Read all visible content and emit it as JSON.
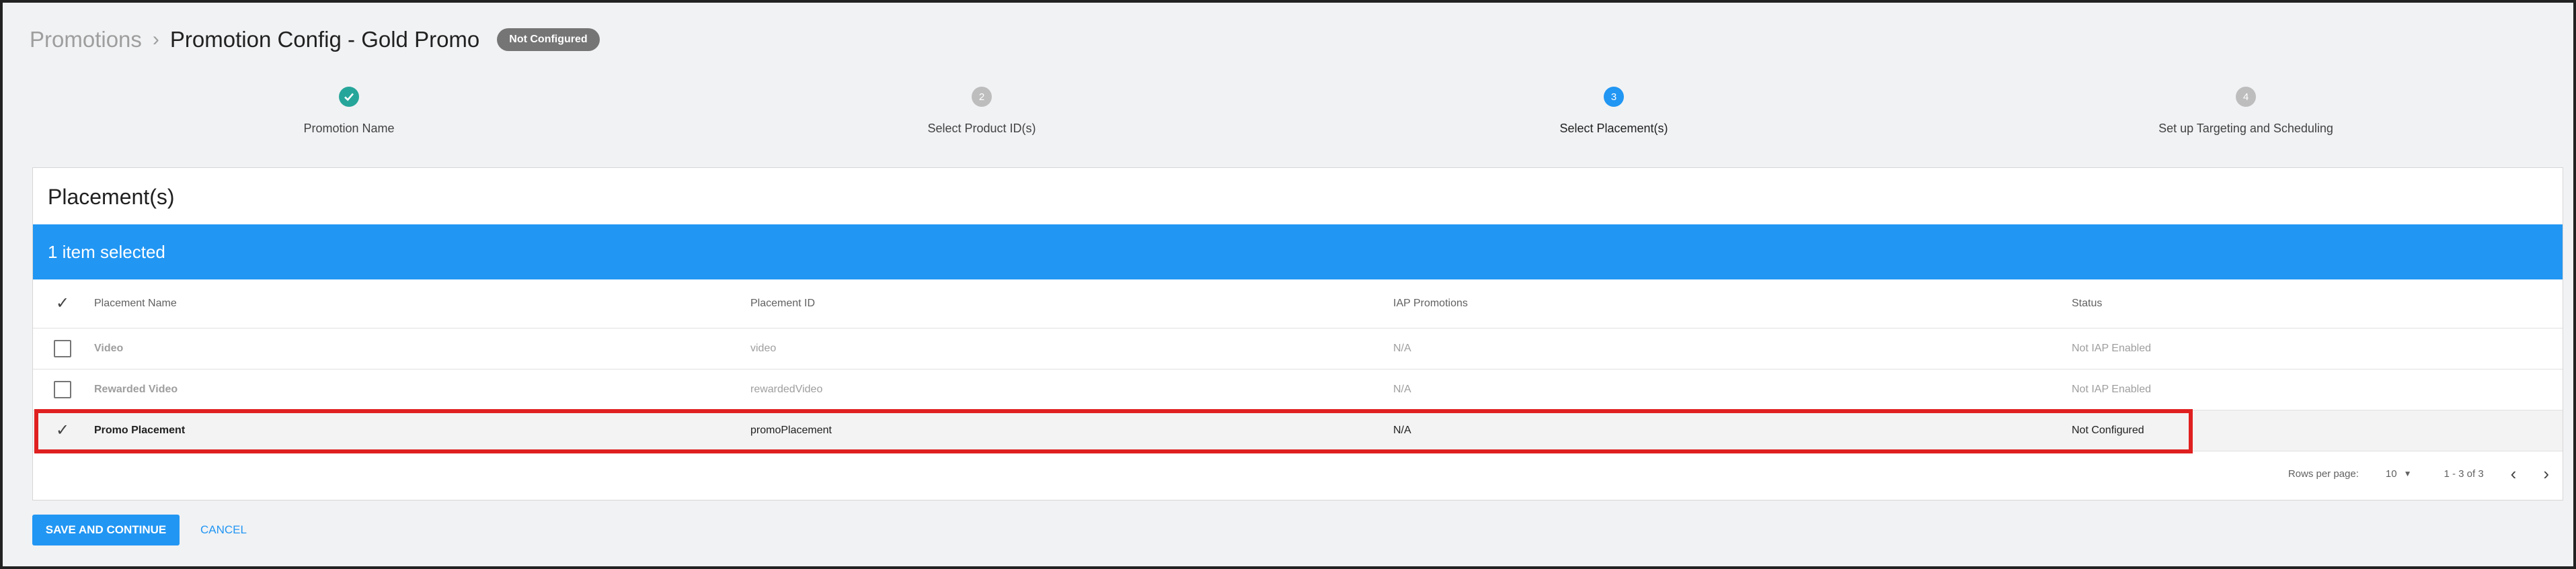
{
  "breadcrumb": {
    "parent": "Promotions",
    "separator": "›",
    "title": "Promotion Config - Gold Promo",
    "badge": "Not Configured"
  },
  "stepper": {
    "steps": [
      {
        "label": "Promotion Name",
        "number": "1",
        "state": "done"
      },
      {
        "label": "Select Product ID(s)",
        "number": "2",
        "state": "todo"
      },
      {
        "label": "Select Placement(s)",
        "number": "3",
        "state": "active"
      },
      {
        "label": "Set up Targeting and Scheduling",
        "number": "4",
        "state": "todo"
      }
    ]
  },
  "card": {
    "title": "Placement(s)",
    "selected_text": "1 item selected",
    "columns": {
      "name": "Placement Name",
      "id": "Placement ID",
      "iap": "IAP Promotions",
      "status": "Status"
    },
    "rows": [
      {
        "name": "Video",
        "id": "video",
        "iap": "N/A",
        "status": "Not IAP Enabled",
        "checked": false
      },
      {
        "name": "Rewarded Video",
        "id": "rewardedVideo",
        "iap": "N/A",
        "status": "Not IAP Enabled",
        "checked": false
      },
      {
        "name": "Promo Placement",
        "id": "promoPlacement",
        "iap": "N/A",
        "status": "Not Configured",
        "checked": true
      }
    ],
    "pager": {
      "rows_per_page_label": "Rows per page:",
      "rows_per_page_value": "10",
      "range": "1 - 3 of 3"
    }
  },
  "footer": {
    "save_label": "SAVE AND CONTINUE",
    "cancel_label": "CANCEL"
  },
  "colors": {
    "accent": "#2196f3",
    "done": "#26a69a",
    "highlight": "#e02020"
  }
}
